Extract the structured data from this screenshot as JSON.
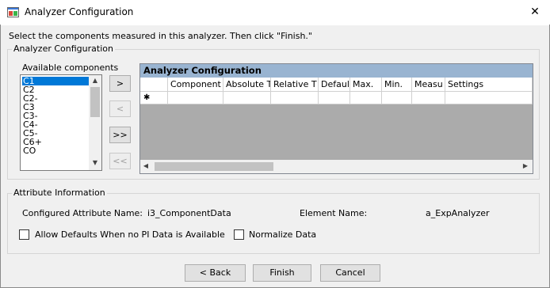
{
  "window": {
    "title": "Analyzer Configuration",
    "close_glyph": "✕"
  },
  "instruction": "Select the components measured in this analyzer. Then click \"Finish.\"",
  "config_group": {
    "label": "Analyzer Configuration",
    "available_label": "Available components",
    "components": [
      "C1",
      "C2",
      "C2-",
      "C3",
      "C3-",
      "C4-",
      "C5-",
      "C6+",
      "CO"
    ],
    "selected_component": "C1",
    "move_buttons": [
      {
        "label": ">",
        "enabled": true
      },
      {
        "label": "<",
        "enabled": false
      },
      {
        "label": ">>",
        "enabled": true
      },
      {
        "label": "<<",
        "enabled": false
      }
    ],
    "grid": {
      "caption": "Analyzer Configuration",
      "columns": [
        "Component",
        "Absolute T",
        "Relative T",
        "Default",
        "Max.",
        "Min.",
        "Measu",
        "Settings"
      ],
      "new_row_glyph": "✱"
    }
  },
  "attribute_group": {
    "label": "Attribute Information",
    "configured_attribute_label": "Configured Attribute Name:",
    "configured_attribute_value": "i3_ComponentData",
    "element_name_label": "Element Name:",
    "element_name_value": "a_ExpAnalyzer",
    "allow_defaults": {
      "label": "Allow Defaults When no PI Data is Available",
      "checked": false
    },
    "normalize_data": {
      "label": "Normalize Data",
      "checked": false
    }
  },
  "buttons": {
    "back": "< Back",
    "finish": "Finish",
    "cancel": "Cancel"
  },
  "colors": {
    "selection": "#0078d7",
    "grid_caption": "#99b4d1",
    "grid_empty": "#ababab"
  }
}
